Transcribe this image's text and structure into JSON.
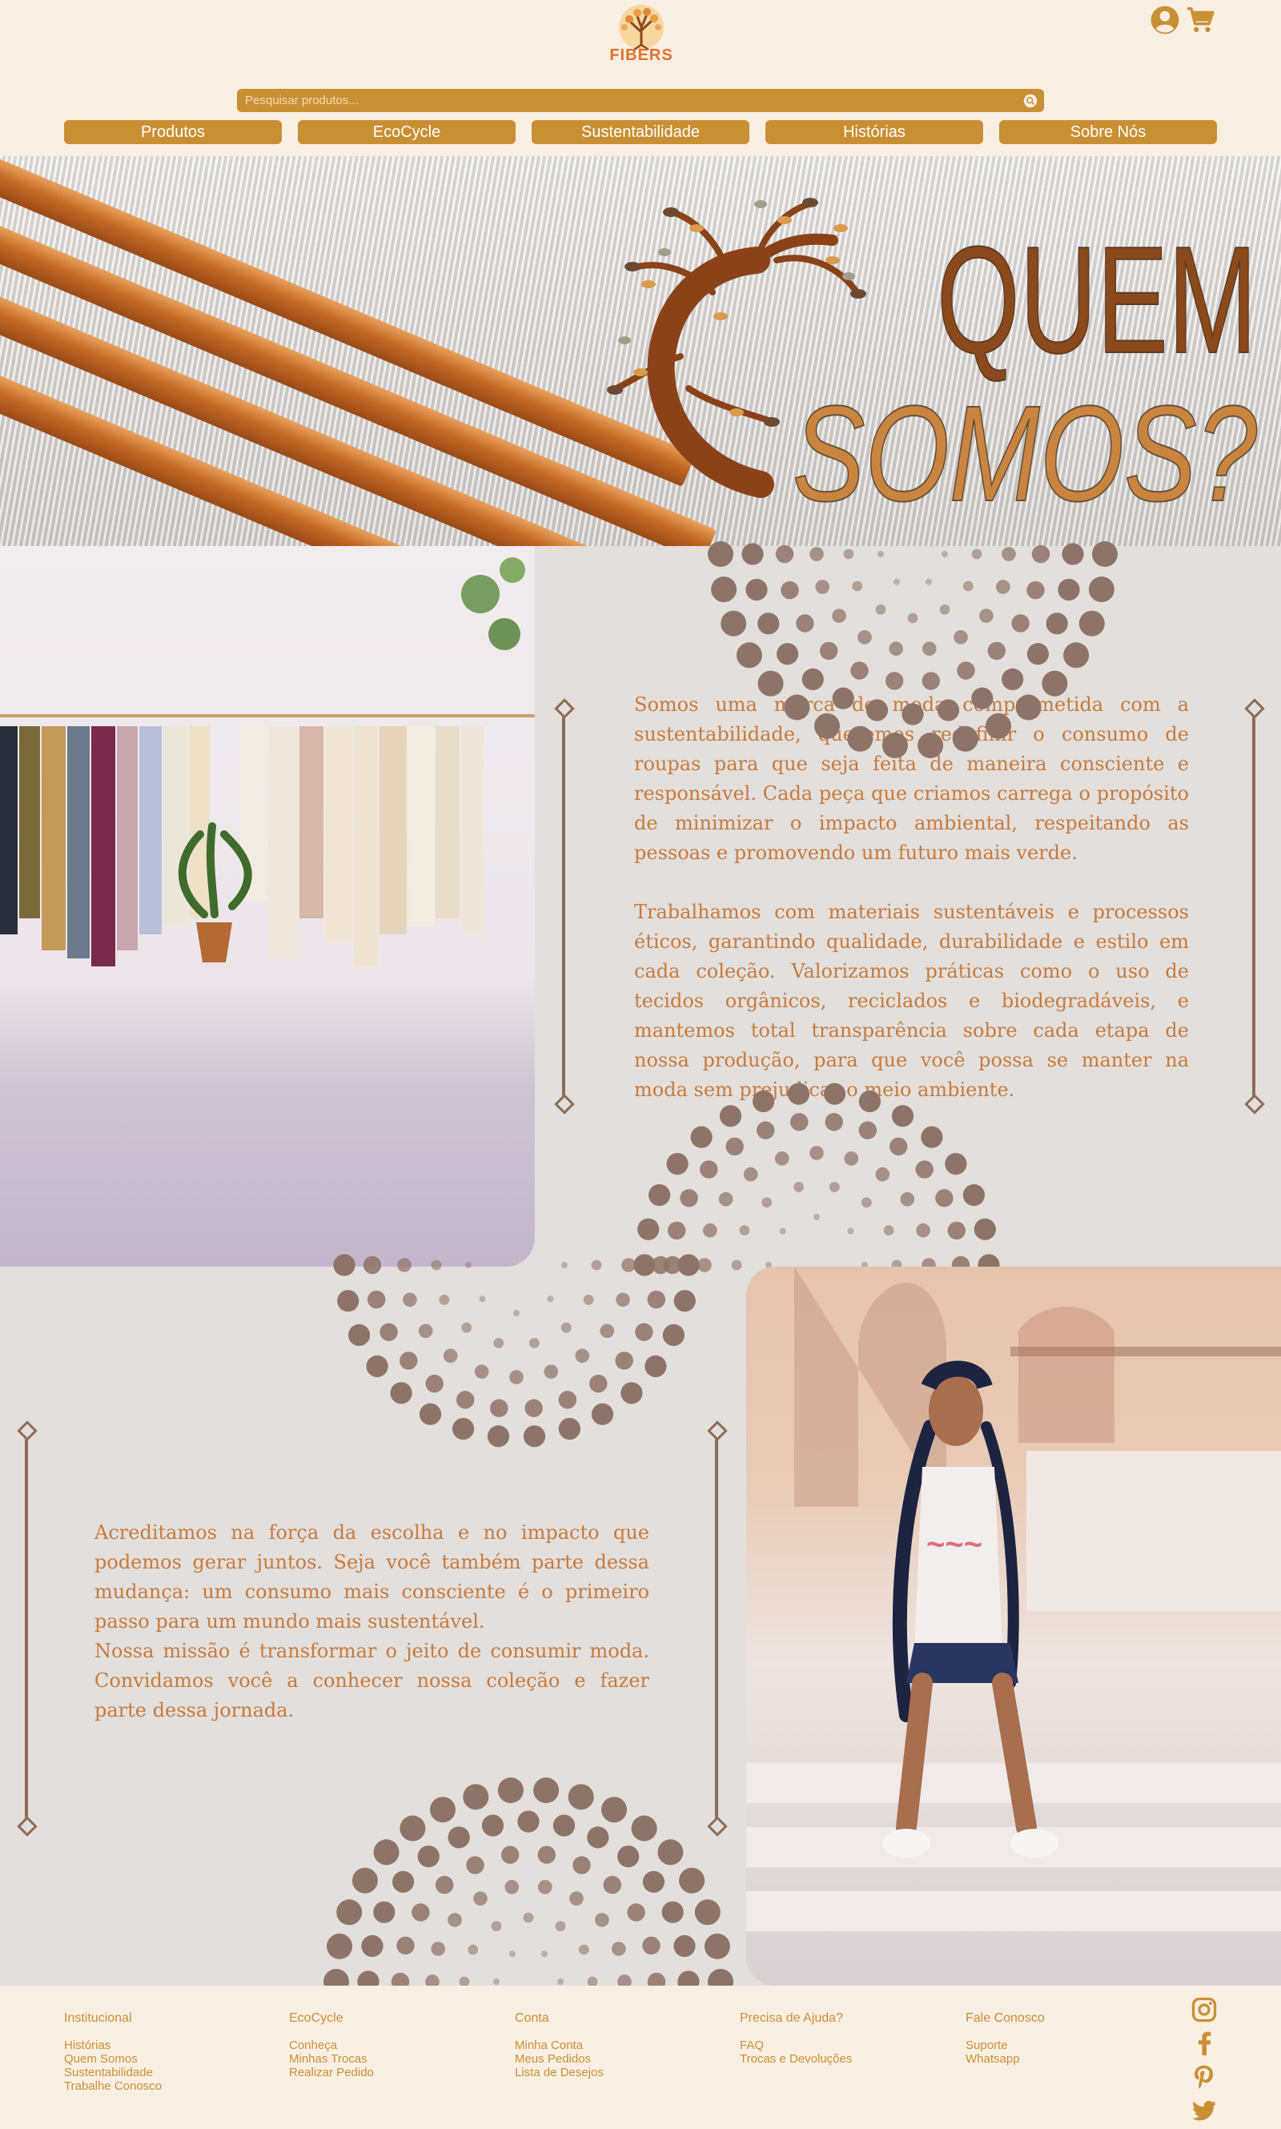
{
  "brand": {
    "logo_text": "FIBERS",
    "accent": "#c98f33",
    "logo_color": "#e2702a",
    "text_color": "#c87a3c"
  },
  "header": {
    "search_placeholder": "Pesquisar produtos...",
    "icons": [
      "user-icon",
      "cart-icon",
      "search-icon"
    ]
  },
  "nav": {
    "items": [
      "Produtos",
      "EcoCycle",
      "Sustentabilidade",
      "Histórias",
      "Sobre Nós"
    ]
  },
  "hero": {
    "title_line1": "QUEM",
    "title_line2": "SOMOS?"
  },
  "about": {
    "p1": "Somos uma marca de moda comprometida com a sustentabilidade, queremos redefinir o consumo de roupas para que seja feita de maneira consciente e responsável. Cada peça que criamos carrega o propósito de minimizar o impacto ambiental, respeitando as pessoas e promovendo um futuro mais verde.",
    "p2": "Trabalhamos com materiais sustentáveis e processos éticos, garantindo qualidade, durabilidade e estilo em cada coleção. Valorizamos práticas como o uso de tecidos orgânicos, reciclados e biodegradáveis, e mantemos total transparência sobre cada etapa de nossa produção, para que você possa se manter na moda sem prejudicar o meio ambiente.",
    "p3a": "Acreditamos na força da escolha e no impacto que podemos gerar juntos. Seja você também parte dessa mudança: um consumo mais consciente é o primeiro passo para um mundo mais sustentável.",
    "p3b": "Nossa missão é transformar o jeito de consumir moda. Convidamos você a conhecer nossa coleção e fazer parte dessa jornada."
  },
  "footer": {
    "columns": [
      {
        "title": "Institucional",
        "links": [
          "Histórias",
          "Quem Somos",
          "Sustentabilidade",
          "Trabalhe Conosco"
        ]
      },
      {
        "title": "EcoCycle",
        "links": [
          "Conheça",
          "Minhas Trocas",
          "Realizar Pedido"
        ]
      },
      {
        "title": "Conta",
        "links": [
          "Minha Conta",
          "Meus Pedidos",
          "Lista de Desejos"
        ]
      },
      {
        "title": "Precisa de Ajuda?",
        "links": [
          "FAQ",
          "Trocas e Devoluções"
        ]
      },
      {
        "title": "Fale Conosco",
        "links": [
          "Suporte",
          "Whatsapp"
        ]
      }
    ],
    "social": [
      "instagram-icon",
      "facebook-icon",
      "pinterest-icon",
      "twitter-icon"
    ]
  }
}
